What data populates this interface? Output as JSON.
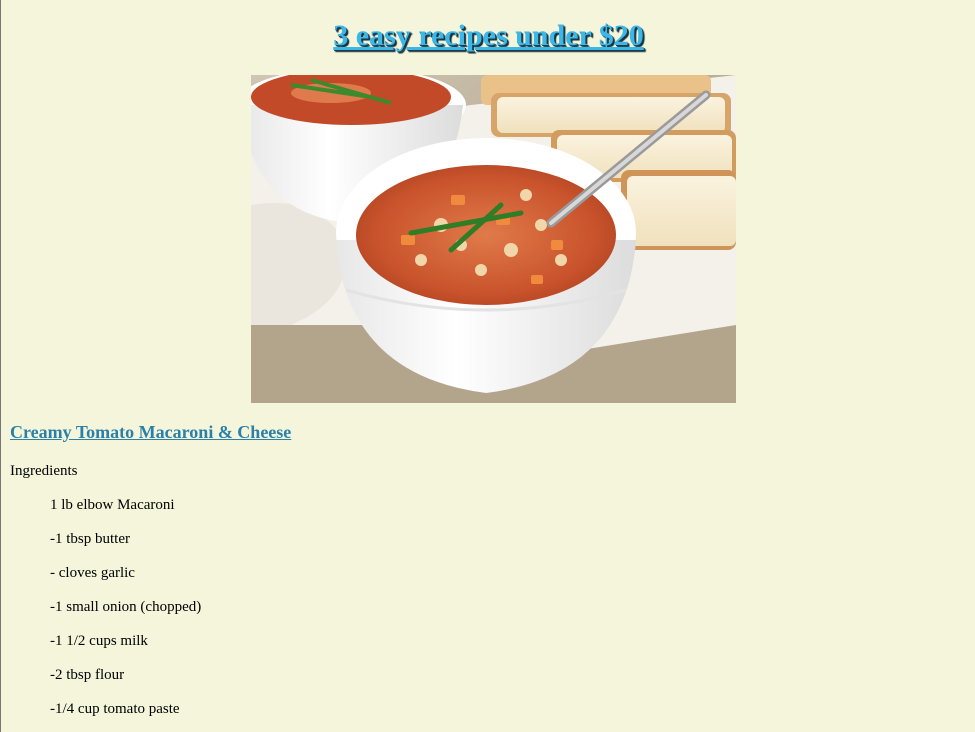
{
  "page": {
    "title": "3 easy recipes under $20"
  },
  "hero_image": {
    "icon": "soup-bowl-photo",
    "description_alt": "Bowls of vegetable and bean tomato stew with bread"
  },
  "recipe": {
    "title": "Creamy Tomato Macaroni & Cheese",
    "ingredients_heading": "Ingredients",
    "ingredients": [
      "1 lb elbow Macaroni",
      "-1 tbsp butter",
      "- cloves garlic",
      "-1 small onion (chopped)",
      "-1 1/2 cups milk",
      "-2 tbsp flour",
      "-1/4 cup tomato paste"
    ]
  },
  "colors": {
    "background": "#f5f5dc",
    "title": "#3bb8e8",
    "link": "#2a80a8"
  }
}
